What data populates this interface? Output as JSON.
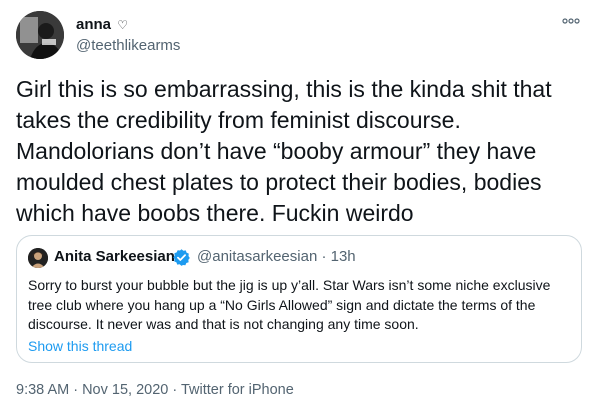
{
  "author": {
    "display_name": "anna",
    "badge": "♡",
    "handle": "@teethlikearms"
  },
  "tweet": {
    "text": "Girl this is so embarrassing, this is the kinda shit that takes the credibility from feminist discourse. Mandolorians don’t have “booby armour” they have moulded chest plates to protect their bodies, bodies which have boobs there. Fuckin weirdo"
  },
  "quoted_tweet": {
    "display_name": "Anita Sarkeesian",
    "verified_icon": "verified-badge-icon",
    "handle_and_time": "@anitasarkeesian · 13h",
    "text": "Sorry to burst your bubble but the jig is up y’all. Star Wars isn’t some niche exclusive tree club where you hang up a “No Girls Allowed” sign and dictate the terms of the discourse. It never was and that is not changing any time soon.",
    "show_thread_label": "Show this thread"
  },
  "metadata": {
    "timestamp": "9:38 AM · Nov 15, 2020 · Twitter for iPhone"
  },
  "colors": {
    "text_primary": "#0f1419",
    "text_secondary": "#536471",
    "link": "#1d9bf0",
    "border": "#cfd9de"
  }
}
